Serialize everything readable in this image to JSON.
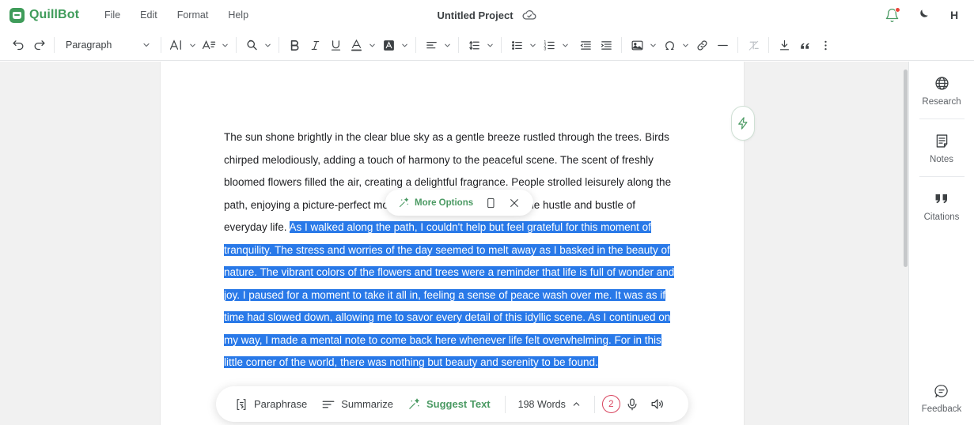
{
  "app": {
    "brand_name": "QuillBot",
    "brand_color": "#3f9c5a",
    "accent_color": "#4b9a63",
    "selection_color": "#2979e8",
    "alert_color": "#d9455f"
  },
  "menubar": {
    "items": [
      {
        "label": "File"
      },
      {
        "label": "Edit"
      },
      {
        "label": "Format"
      },
      {
        "label": "Help"
      }
    ]
  },
  "document": {
    "title": "Untitled Project",
    "save_status_icon": "cloud-check-icon"
  },
  "topright": {
    "notifications_icon": "bell-icon",
    "has_notification": true,
    "theme_icon": "moon-icon",
    "avatar_initial": "H"
  },
  "toolbar": {
    "undo_label": "undo-icon",
    "redo_label": "redo-icon",
    "paragraph_style": "Paragraph",
    "items": [
      {
        "name": "font-family",
        "icon": "font-family-icon",
        "caret": true
      },
      {
        "name": "font-size",
        "icon": "font-size-icon",
        "caret": true
      },
      {
        "name": "find-replace",
        "icon": "find-replace-icon",
        "caret": true
      },
      {
        "name": "bold",
        "icon": "bold-icon",
        "caret": false
      },
      {
        "name": "italic",
        "icon": "italic-icon",
        "caret": false
      },
      {
        "name": "underline",
        "icon": "underline-icon",
        "caret": false
      },
      {
        "name": "text-color",
        "icon": "text-color-icon",
        "caret": true
      },
      {
        "name": "highlight-color",
        "icon": "highlight-color-icon",
        "caret": true
      },
      {
        "name": "align",
        "icon": "align-left-icon",
        "caret": true
      },
      {
        "name": "line-spacing",
        "icon": "line-spacing-icon",
        "caret": true
      },
      {
        "name": "bulleted-list",
        "icon": "bulleted-list-icon",
        "caret": true
      },
      {
        "name": "numbered-list",
        "icon": "numbered-list-icon",
        "caret": true
      },
      {
        "name": "decrease-indent",
        "icon": "decrease-indent-icon",
        "caret": false
      },
      {
        "name": "increase-indent",
        "icon": "increase-indent-icon",
        "caret": false
      },
      {
        "name": "insert-image",
        "icon": "image-icon",
        "caret": true
      },
      {
        "name": "special-character",
        "icon": "omega-icon",
        "caret": true
      },
      {
        "name": "insert-link",
        "icon": "link-icon",
        "caret": false
      },
      {
        "name": "horizontal-rule",
        "icon": "horizontal-rule-icon",
        "caret": false
      },
      {
        "name": "clear-formatting",
        "icon": "clear-formatting-icon",
        "caret": false
      },
      {
        "name": "download",
        "icon": "download-icon",
        "caret": false
      },
      {
        "name": "block-quote",
        "icon": "quote-icon",
        "caret": false
      },
      {
        "name": "more-toolbar",
        "icon": "more-vertical-icon",
        "caret": false
      }
    ]
  },
  "editor": {
    "paragraph_before_selection": "The sun shone brightly in the clear blue sky as a gentle breeze rustled through the trees. Birds chirped melodiously, adding a touch of harmony to the peaceful scene. The scent of freshly bloomed flowers filled the air, creating a delightful fragrance. People strolled leisurely along the path, enjoying a picture-perfect moment, a serene oasis amidst the hustle and bustle of everyday life. ",
    "selected_text": "As I walked along the path, I couldn't help but feel grateful for this moment of tranquility. The stress and worries of the day seemed to melt away as I basked in the beauty of nature. The vibrant colors of the flowers and trees were a reminder that life is full of wonder and joy. I paused for a moment to take it all in, feeling a sense of peace wash over me. It was as if time had slowed down, allowing me to savor every detail of this idyllic scene. As I continued on my way, I made a mental note to come back here whenever life felt overwhelming. For in this little corner of the world, there was nothing but beauty and serenity to be found."
  },
  "zap_button": {
    "icon": "lightning-bolt-icon"
  },
  "more_options_popup": {
    "label": "More Options",
    "sparkle_icon": "sparkle-icon",
    "copy_icon": "copy-icon",
    "close_icon": "close-icon"
  },
  "bottombar": {
    "paraphrase_label": "Paraphrase",
    "paraphrase_icon": "paraphrase-icon",
    "summarize_label": "Summarize",
    "summarize_icon": "summarize-icon",
    "suggest_label": "Suggest Text",
    "suggest_icon": "sparkle-icon",
    "word_count": "198 Words",
    "word_count_caret": "chevron-up-icon",
    "issue_count": "2",
    "mic_icon": "microphone-icon",
    "speaker_icon": "speaker-icon"
  },
  "rail": {
    "items": [
      {
        "label": "Research",
        "icon": "globe-icon"
      },
      {
        "label": "Notes",
        "icon": "notes-icon"
      },
      {
        "label": "Citations",
        "icon": "quotation-marks-icon"
      }
    ],
    "feedback": {
      "label": "Feedback",
      "icon": "feedback-chat-icon"
    }
  }
}
